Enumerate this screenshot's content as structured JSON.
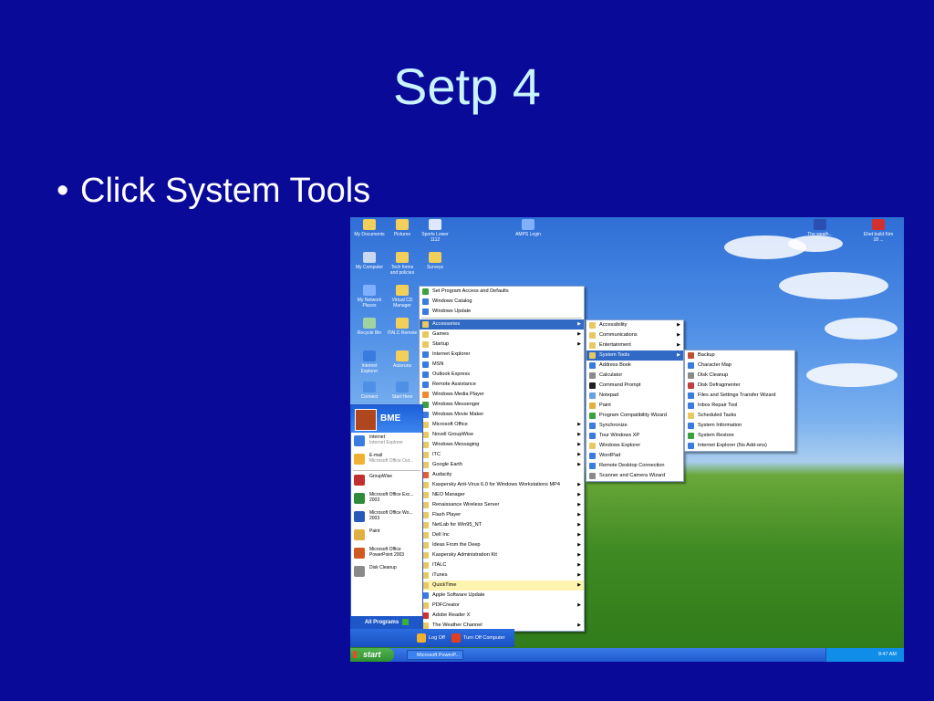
{
  "slide": {
    "title": "Setp 4",
    "bullet": "Click System Tools"
  },
  "desktop_icons": [
    {
      "label": "My Documents",
      "icon": "documents-icon",
      "color": "#f2cf5a"
    },
    {
      "label": "Pictures",
      "icon": "folder-icon",
      "color": "#f2cf5a"
    },
    {
      "label": "Sports Lower 1112",
      "icon": "word-doc-icon",
      "color": "#e0e8ff"
    },
    {
      "label": "AMPS Login",
      "icon": "shortcut-icon",
      "color": "#7fb0ff"
    },
    {
      "label": "The weath...",
      "icon": "weather-icon",
      "color": "#2a4fb0"
    },
    {
      "label": "Ehet build Kim 18 ...",
      "icon": "kaspersky-icon",
      "color": "#d43030"
    },
    {
      "label": "My Computer",
      "icon": "computer-icon",
      "color": "#c8d8f0"
    },
    {
      "label": "Tech forms and policies",
      "icon": "folder-icon",
      "color": "#f2cf5a"
    },
    {
      "label": "Surveys",
      "icon": "folder-icon",
      "color": "#f2cf5a"
    },
    {
      "label": "My Network Places",
      "icon": "network-icon",
      "color": "#7fb0ff"
    },
    {
      "label": "Virtual CD Manager",
      "icon": "folder-icon",
      "color": "#f2cf5a"
    },
    {
      "label": "Recycle Bin",
      "icon": "recycle-bin-icon",
      "color": "#9fd3a0"
    },
    {
      "label": "ITALC Remote",
      "icon": "folder-icon",
      "color": "#f2cf5a"
    },
    {
      "label": "Internet Explorer",
      "icon": "ie-icon",
      "color": "#3a7be0"
    },
    {
      "label": "Autoruns",
      "icon": "folder-icon",
      "color": "#f2cf5a"
    },
    {
      "label": "Connect",
      "icon": "connect-icon",
      "color": "#4f8fe6"
    },
    {
      "label": "Start Here",
      "icon": "start-here-icon",
      "color": "#4f8fe6"
    }
  ],
  "start_panel": {
    "user": "BME",
    "pinned": [
      {
        "title": "Internet",
        "sub": "Internet Explorer",
        "icon": "ie-icon",
        "color": "#3a7be0"
      },
      {
        "title": "E-mail",
        "sub": "Microsoft Office Out...",
        "icon": "email-icon",
        "color": "#f0b030"
      }
    ],
    "recent": [
      {
        "title": "GroupWise",
        "icon": "groupwise-icon",
        "color": "#c03030"
      },
      {
        "title": "Microsoft Office Exc... 2003",
        "icon": "excel-icon",
        "color": "#2f8a3a"
      },
      {
        "title": "Microsoft Office Wo... 2003",
        "icon": "word-icon",
        "color": "#2a5ab8"
      },
      {
        "title": "Paint",
        "icon": "paint-icon",
        "color": "#e0b040"
      },
      {
        "title": "Microsoft Office PowerPoint 2003",
        "icon": "powerpoint-icon",
        "color": "#d05a20"
      },
      {
        "title": "Disk Cleanup",
        "icon": "disk-cleanup-icon",
        "color": "#8a8a8a"
      }
    ],
    "all_programs": "All Programs",
    "logoff": "Log Off",
    "turnoff": "Turn Off Computer"
  },
  "programs_menu": {
    "top": [
      {
        "label": "Set Program Access and Defaults",
        "color": "#3aa040"
      },
      {
        "label": "Windows Catalog",
        "color": "#3a7be0"
      },
      {
        "label": "Windows Update",
        "color": "#3a7be0"
      }
    ],
    "items": [
      {
        "label": "Accessories",
        "arrow": true,
        "state": "sel"
      },
      {
        "label": "Games",
        "arrow": true
      },
      {
        "label": "Startup",
        "arrow": true
      },
      {
        "label": "Internet Explorer",
        "color": "#3a7be0"
      },
      {
        "label": "MSN",
        "color": "#3a7be0"
      },
      {
        "label": "Outlook Express",
        "color": "#3a7be0"
      },
      {
        "label": "Remote Assistance",
        "color": "#3a7be0"
      },
      {
        "label": "Windows Media Player",
        "color": "#f08a30"
      },
      {
        "label": "Windows Messenger",
        "color": "#3aa040"
      },
      {
        "label": "Windows Movie Maker",
        "color": "#3a7be0"
      },
      {
        "label": "Microsoft Office",
        "arrow": true
      },
      {
        "label": "Novell GroupWise",
        "arrow": true
      },
      {
        "label": "Windows Messaging",
        "arrow": true
      },
      {
        "label": "ITC",
        "arrow": true
      },
      {
        "label": "Google Earth",
        "arrow": true
      },
      {
        "label": "Audacity",
        "color": "#e06030"
      },
      {
        "label": "Kaspersky Anti-Virus 6.0 for Windows Workstations MP4",
        "arrow": true
      },
      {
        "label": "NEO Manager",
        "arrow": true
      },
      {
        "label": "Renaissance Wireless Server",
        "arrow": true
      },
      {
        "label": "Flash Player",
        "arrow": true
      },
      {
        "label": "NetLab for Win95_NT",
        "arrow": true
      },
      {
        "label": "Dell Inc",
        "arrow": true
      },
      {
        "label": "Ideas From the Deep",
        "arrow": true
      },
      {
        "label": "Kaspersky Administration Kit",
        "arrow": true
      },
      {
        "label": "ITALC",
        "arrow": true
      },
      {
        "label": "iTunes",
        "arrow": true
      },
      {
        "label": "QuickTime",
        "arrow": true,
        "state": "hl"
      },
      {
        "label": "Apple Software Update",
        "color": "#3a7be0"
      },
      {
        "label": "PDFCreator",
        "arrow": true
      },
      {
        "label": "Adobe Reader X",
        "color": "#d03030"
      },
      {
        "label": "The Weather Channel",
        "arrow": true
      }
    ]
  },
  "accessories_menu": [
    {
      "label": "Accessibility",
      "arrow": true
    },
    {
      "label": "Communications",
      "arrow": true
    },
    {
      "label": "Entertainment",
      "arrow": true
    },
    {
      "label": "System Tools",
      "arrow": true,
      "state": "sel"
    },
    {
      "label": "Address Book",
      "color": "#3a7be0"
    },
    {
      "label": "Calculator",
      "color": "#8a8a8a"
    },
    {
      "label": "Command Prompt",
      "color": "#202020"
    },
    {
      "label": "Notepad",
      "color": "#6aa0e0"
    },
    {
      "label": "Paint",
      "color": "#e0b040"
    },
    {
      "label": "Program Compatibility Wizard",
      "color": "#3aa040"
    },
    {
      "label": "Synchronize",
      "color": "#3a7be0"
    },
    {
      "label": "Tour Windows XP",
      "color": "#3a7be0"
    },
    {
      "label": "Windows Explorer",
      "color": "#e8c860"
    },
    {
      "label": "WordPad",
      "color": "#3a7be0"
    },
    {
      "label": "Remote Desktop Connection",
      "color": "#3a7be0"
    },
    {
      "label": "Scanner and Camera Wizard",
      "color": "#8a8a8a"
    }
  ],
  "system_tools_menu": [
    {
      "label": "Backup",
      "color": "#c05030"
    },
    {
      "label": "Character Map",
      "color": "#3a7be0"
    },
    {
      "label": "Disk Cleanup",
      "color": "#8a8a8a"
    },
    {
      "label": "Disk Defragmenter",
      "color": "#c04040"
    },
    {
      "label": "Files and Settings Transfer Wizard",
      "color": "#3a7be0"
    },
    {
      "label": "Inbox Repair Tool",
      "color": "#3a7be0"
    },
    {
      "label": "Scheduled Tasks",
      "color": "#e8c860"
    },
    {
      "label": "System Information",
      "color": "#3a7be0"
    },
    {
      "label": "System Restore",
      "color": "#3aa040"
    },
    {
      "label": "Internet Explorer (No Add-ons)",
      "color": "#3a7be0"
    }
  ],
  "taskbar": {
    "start": "start",
    "task": "Microsoft PowerP...",
    "clock": "9:47 AM"
  }
}
